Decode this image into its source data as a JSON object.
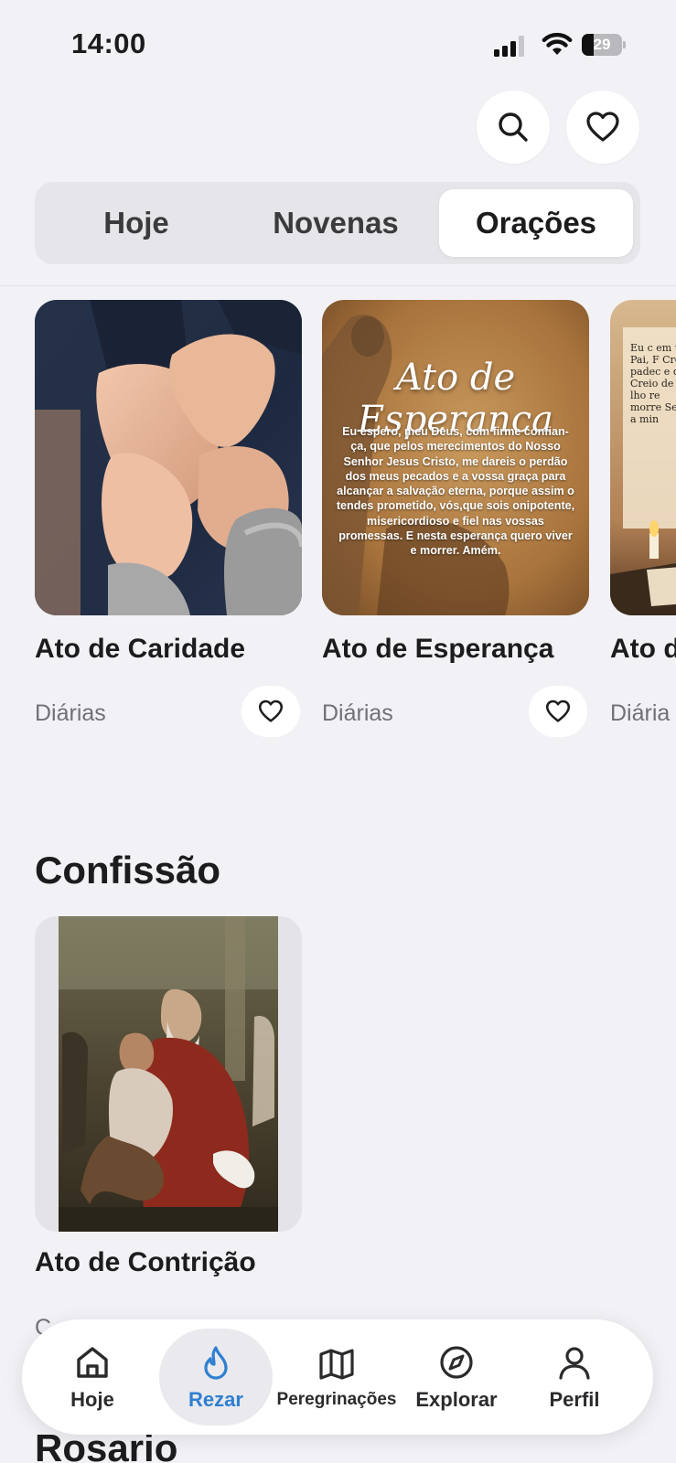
{
  "status_bar": {
    "time": "14:00",
    "battery": "29",
    "battery_level": 0.29
  },
  "header": {
    "search_icon": "search-icon",
    "favorites_icon": "heart-icon"
  },
  "tabs": [
    {
      "label": "Hoje",
      "active": false
    },
    {
      "label": "Novenas",
      "active": false
    },
    {
      "label": "Orações",
      "active": true
    }
  ],
  "prayers": [
    {
      "title": "Ato de Caridade",
      "category": "Diárias",
      "image": "hands-holding"
    },
    {
      "title": "Ato de Esperança",
      "category": "Diárias",
      "image": "jesus-praying",
      "image_title": "Ato de Esperanca",
      "image_text": "Eu espero, meu Deus, com firme confian-ça, que pelos merecimentos do Nosso Senhor Jesus Cristo, me dareis o perdão dos meus pecados e a vossa graça para alcançar a salvação eterna, porque assim o tendes prometido, vós,que sois onipotente, misericordioso e fiel nas vossas promessas. E nesta esperança quero viver e morrer. Amém."
    },
    {
      "title": "Ato d",
      "category": "Diária",
      "image": "candle-book",
      "image_text": "Eu c em tr Pai, F Creio padec e que Creio de Cr lho re morre Senh a min"
    }
  ],
  "sections": [
    {
      "title": "Confissão",
      "items": [
        {
          "title": "Ato de Contrição",
          "category": "C",
          "image": "prodigal-son-painting"
        }
      ]
    },
    {
      "title": "Rosario"
    }
  ],
  "bottom_nav": [
    {
      "label": "Hoje",
      "icon": "home-icon",
      "active": false
    },
    {
      "label": "Rezar",
      "icon": "flame-icon",
      "active": true
    },
    {
      "label": "Peregrinações",
      "icon": "map-icon",
      "active": false
    },
    {
      "label": "Explorar",
      "icon": "compass-icon",
      "active": false
    },
    {
      "label": "Perfil",
      "icon": "user-icon",
      "active": false
    }
  ],
  "colors": {
    "background": "#f2f2f6",
    "accent": "#2f7fd0",
    "card": "#ffffff"
  }
}
